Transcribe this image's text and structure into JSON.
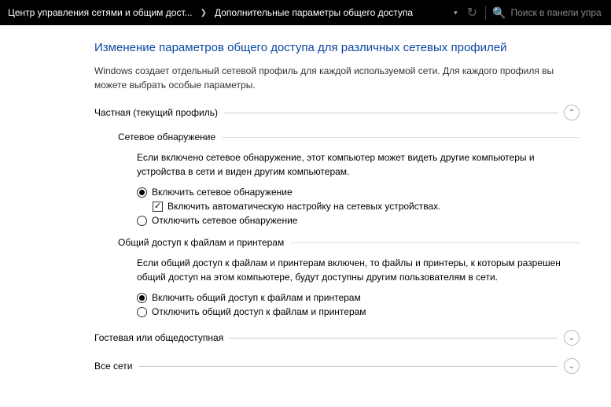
{
  "header": {
    "breadcrumb": {
      "part1": "Центр управления сетями и общим дост...",
      "part2": "Дополнительные параметры общего доступа"
    },
    "search_placeholder": "Поиск в панели упра"
  },
  "page": {
    "title": "Изменение параметров общего доступа для различных сетевых профилей",
    "subtitle": "Windows создает отдельный сетевой профиль для каждой используемой сети. Для каждого профиля вы можете выбрать особые параметры."
  },
  "sections": {
    "private": {
      "title": "Частная (текущий профиль)",
      "network_discovery": {
        "title": "Сетевое обнаружение",
        "desc": "Если включено сетевое обнаружение, этот компьютер может видеть другие компьютеры и устройства в сети и виден другим компьютерам.",
        "opt_on": "Включить сетевое обнаружение",
        "opt_auto": "Включить автоматическую настройку на сетевых устройствах.",
        "opt_off": "Отключить сетевое обнаружение"
      },
      "file_printer": {
        "title": "Общий доступ к файлам и принтерам",
        "desc": "Если общий доступ к файлам и принтерам включен, то файлы и принтеры, к которым разрешен общий доступ на этом компьютере, будут доступны другим пользователям в сети.",
        "opt_on": "Включить общий доступ к файлам и принтерам",
        "opt_off": "Отключить общий доступ к файлам и принтерам"
      }
    },
    "guest": {
      "title": "Гостевая или общедоступная"
    },
    "all": {
      "title": "Все сети"
    }
  }
}
